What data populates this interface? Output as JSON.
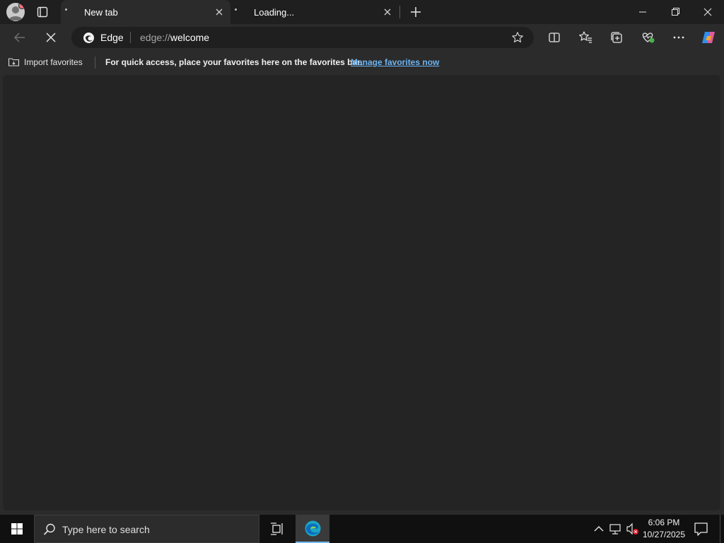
{
  "tabs": [
    {
      "label": "New tab",
      "active": true
    },
    {
      "label": "Loading...",
      "active": false
    }
  ],
  "toolbar": {
    "site_name": "Edge",
    "url_prefix": "edge://",
    "url_path": "welcome"
  },
  "favorites_bar": {
    "import_label": "Import favorites",
    "message": "For quick access, place your favorites here on the favorites bar.",
    "manage_link": "Manage favorites now"
  },
  "taskbar": {
    "search_placeholder": "Type here to search",
    "time": "6:06 PM",
    "date": "10/27/2025"
  },
  "icons": {
    "profile": "profile-avatar",
    "tab_actions": "tab-actions-icon",
    "close": "close-icon",
    "new_tab": "plus-icon",
    "back": "back-arrow-icon",
    "stop": "stop-icon",
    "favorite": "star-icon",
    "split_screen": "split-screen-icon",
    "favorites": "favorites-icon",
    "collections": "collections-icon",
    "performance": "heartbeat-icon",
    "menu": "more-icon",
    "copilot": "copilot-icon"
  },
  "colors": {
    "accent": "#76b9ed",
    "link": "#6cb4f2",
    "background": "#2b2b2b"
  }
}
